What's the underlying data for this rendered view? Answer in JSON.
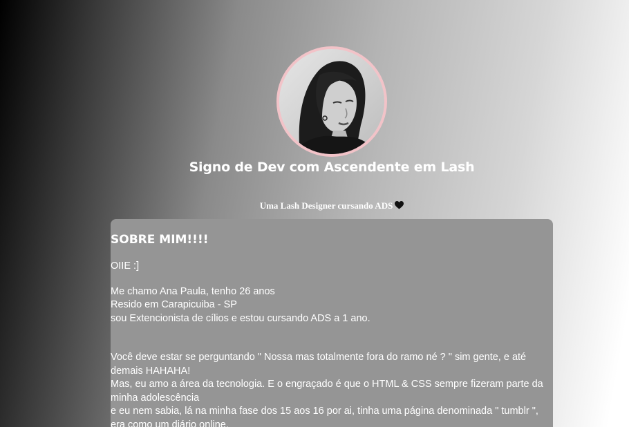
{
  "profile": {
    "title": "Signo de Dev com Ascendente em Lash",
    "tagline": "Uma Lash Designer cursando ADS",
    "tagline_icon": "black-heart-icon",
    "avatar_border_color": "#f2c3c8"
  },
  "about": {
    "heading": "SOBRE MIM!!!!",
    "greeting": "OIIE :]",
    "intro_lines": [
      "Me chamo Ana Paula, tenho 26 anos",
      "Resido em Carapicuiba - SP",
      "sou Extencionista de cílios e estou cursando ADS a 1 ano."
    ],
    "story_lines": [
      "Você deve estar se perguntando \" Nossa mas totalmente fora do ramo né ? \" sim gente, e até demais HAHAHA!",
      "Mas, eu amo a área da tecnologia. E o engraçado é que o HTML & CSS sempre fizeram parte da minha adolescência",
      "e eu nem sabia, lá na minha fase dos 15 aos 16 por ai, tinha uma página denominada \" tumblr \", era como um diário online,"
    ]
  }
}
